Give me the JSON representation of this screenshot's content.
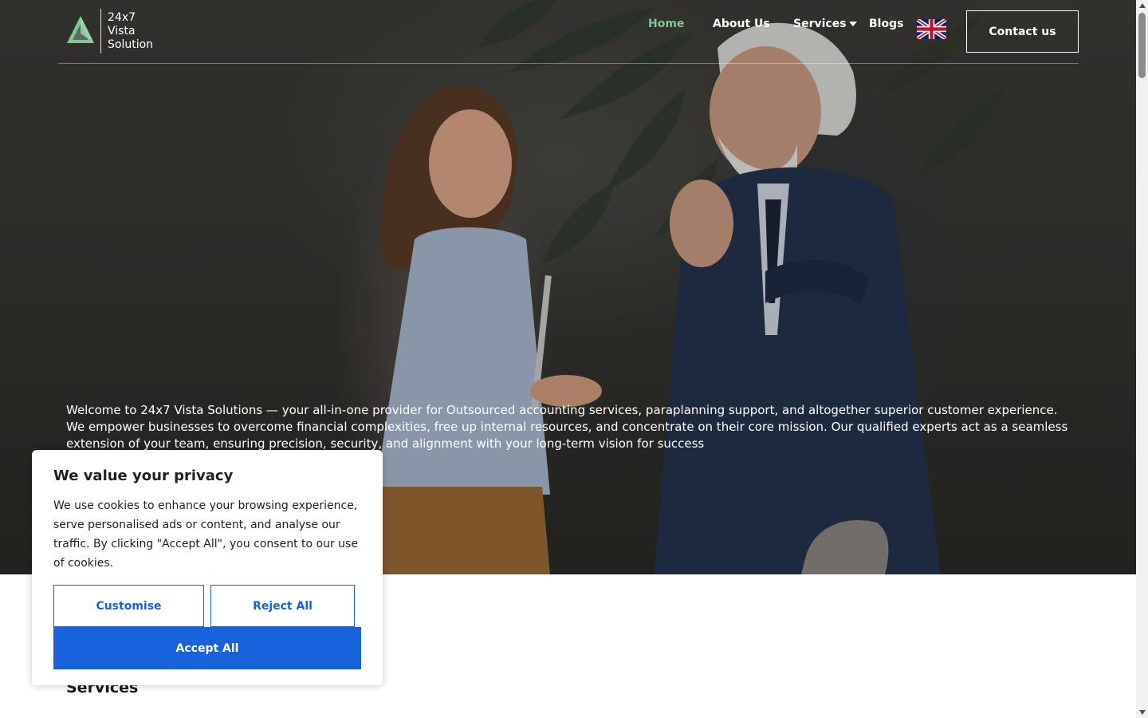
{
  "logo": {
    "line1": "24x7",
    "line2": "Vista",
    "line3": "Solution"
  },
  "nav": {
    "home": "Home",
    "about": "About Us",
    "services": "Services",
    "blogs": "Blogs",
    "contact": "Contact us"
  },
  "hero": {
    "text": "Welcome to 24x7 Vista Solutions — your all-in-one provider for Outsourced accounting services, paraplanning support, and altogether superior customer experience. We empower businesses to overcome financial complexities, free up internal resources, and concentrate on their core mission. Our qualified experts act as a seamless extension of your team, ensuring precision, security, and alignment with your long-term vision for success"
  },
  "section": {
    "services_heading": "Services"
  },
  "cookie": {
    "title": "We value your privacy",
    "body": "We use cookies to enhance your browsing experience, serve personalised ads or content, and analyse our traffic. By clicking \"Accept All\", you consent to our use of cookies.",
    "customise": "Customise",
    "reject": "Reject All",
    "accept": "Accept All"
  },
  "colors": {
    "nav_active": "#7ec894",
    "cookie_primary": "#1863dc",
    "logo_green": "#7ec894"
  },
  "icons": {
    "language": "uk-flag-icon",
    "services_dropdown": "caret-down-icon",
    "logo": "triangle-logo-icon"
  }
}
